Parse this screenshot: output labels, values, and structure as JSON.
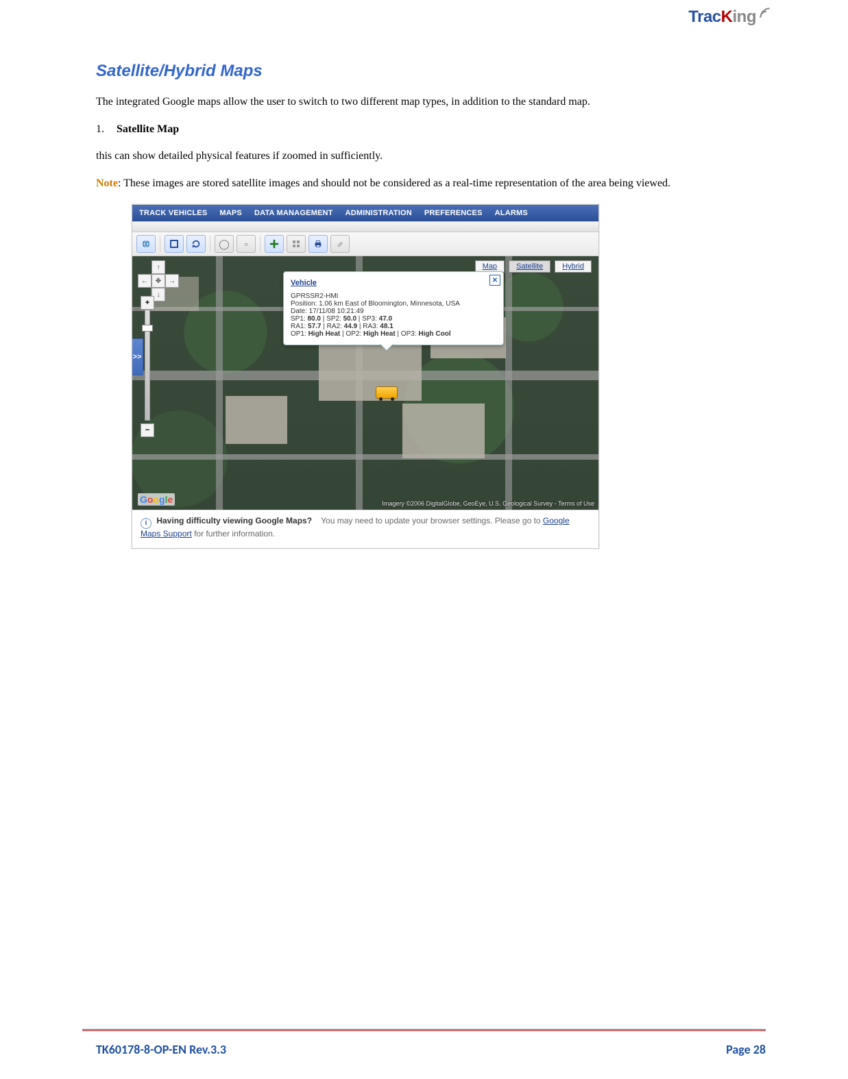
{
  "brand": {
    "p1": "Trac",
    "p2": "K",
    "p3": "ing"
  },
  "heading": "Satellite/Hybrid Maps",
  "intro": "The integrated Google maps allow the user to switch to two different map types, in addition to the standard map.",
  "list": {
    "num": "1.",
    "title": "Satellite Map",
    "line1": "this can show detailed physical features if zoomed in sufficiently.",
    "note_label": "Note",
    "note_text": ": These images are stored satellite images and should not be considered as a real-time representation of the area being viewed."
  },
  "app": {
    "menu": [
      "TRACK VEHICLES",
      "MAPS",
      "DATA MANAGEMENT",
      "ADMINISTRATION",
      "PREFERENCES",
      "ALARMS"
    ],
    "expand": ">>",
    "nav": {
      "up": "↑",
      "down": "↓",
      "left": "←",
      "right": "→",
      "center": "✥",
      "plus": "+",
      "minus": "−"
    },
    "maptypes": {
      "map": "Map",
      "satellite": "Satellite",
      "hybrid": "Hybrid"
    },
    "popup": {
      "title": "Vehicle",
      "id": "GPRSSR2-HMI",
      "pos": "Position: 1.06 km East of Bloomington, Minnesota, USA",
      "date": "Date: 17/11/08 10:21:49",
      "sp_label": "SP1: ",
      "sp1": "80.0",
      "sp_sep1": " | SP2: ",
      "sp2": "50.0",
      "sp_sep2": " | SP3: ",
      "sp3": "47.0",
      "ra_label": "RA1: ",
      "ra1": "57.7",
      "ra_sep1": " | RA2: ",
      "ra2": "44.9",
      "ra_sep2": " | RA3: ",
      "ra3": "48.1",
      "op_label": "OP1: ",
      "op1": "High Heat",
      "op_sep1": " | OP2: ",
      "op2": "High Heat",
      "op_sep2": " | OP3: ",
      "op3": "High Cool",
      "close": "✕"
    },
    "attrib": "Imagery ©2006 DigitalGlobe, GeoEye, U.S. Geological Survey - Terms of Use",
    "help": {
      "q": "Having difficulty viewing Google Maps?",
      "t1": "You may need to update your browser settings. Please go to ",
      "link": "Google Maps Support",
      "t2": " for further information."
    },
    "google": {
      "g": "G",
      "o1": "o",
      "o2": "o",
      "gl": "g",
      "l": "l",
      "e": "e"
    }
  },
  "footer": {
    "doc": "TK60178-8-OP-EN Rev.3.3",
    "page_label": "Page  ",
    "page_num": "28"
  }
}
